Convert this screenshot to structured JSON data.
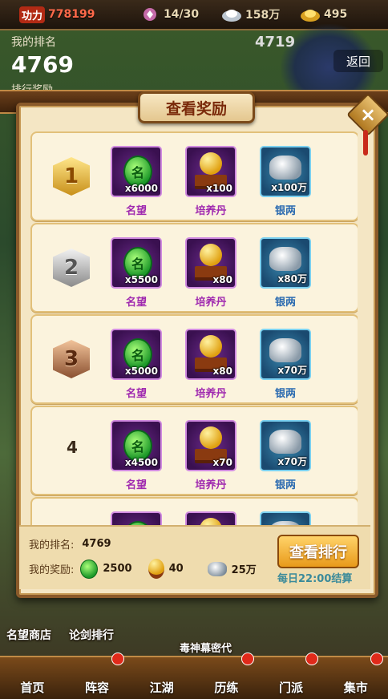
{
  "topbar": {
    "power_tag": "功力",
    "power": "778199",
    "stamina": "14/30",
    "silver": "158万",
    "gold": "495"
  },
  "background": {
    "my_rank_label": "我的排名",
    "my_rank_value": "4769",
    "rank_reward_label": "排行奖励",
    "score": "4719",
    "back_label": "返回"
  },
  "dialog": {
    "title": "查看奖励",
    "close_label": "×"
  },
  "reward_names": {
    "prestige": "名望",
    "pill": "培养丹",
    "silver": "银两"
  },
  "rewards": [
    {
      "rank": "1",
      "medal": "gold",
      "prestige": "x6000",
      "pill": "x100",
      "silver": "x100万"
    },
    {
      "rank": "2",
      "medal": "silver",
      "prestige": "x5500",
      "pill": "x80",
      "silver": "x80万"
    },
    {
      "rank": "3",
      "medal": "bronze",
      "prestige": "x5000",
      "pill": "x80",
      "silver": "x70万"
    },
    {
      "rank": "4",
      "medal": "none",
      "prestige": "x4500",
      "pill": "x70",
      "silver": "x70万"
    }
  ],
  "footer": {
    "my_rank_label": "我的排名:",
    "my_rank_value": "4769",
    "my_reward_label": "我的奖励:",
    "reward_prestige": "2500",
    "reward_pill": "40",
    "reward_silver": "25万",
    "view_rank_button": "查看排行",
    "settle_time": "每日22:00结算"
  },
  "scene": {
    "shop_label": "名望商店",
    "sword_rank_label": "论剑排行",
    "event_label": "毒神幕密代"
  },
  "nav": [
    "首页",
    "阵容",
    "江湖",
    "历练",
    "门派",
    "集市"
  ]
}
